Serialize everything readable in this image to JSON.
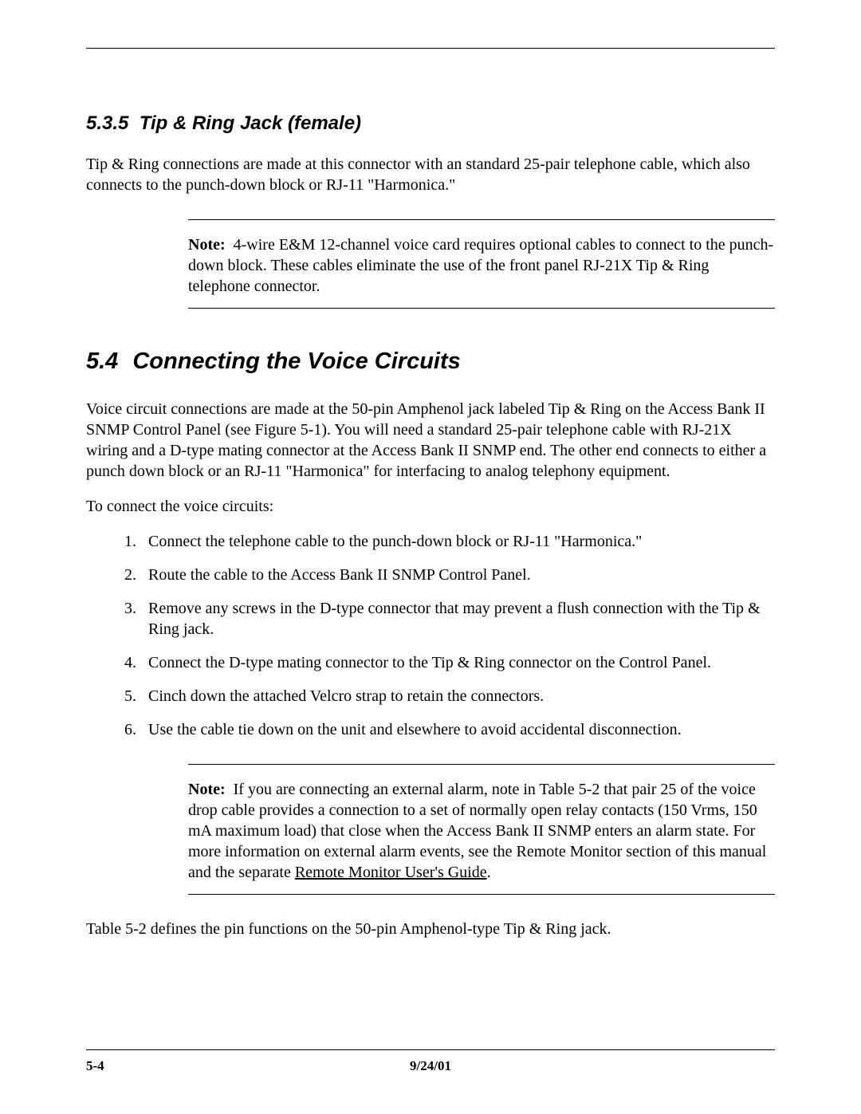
{
  "subsection": {
    "number": "5.3.5",
    "title": "Tip & Ring Jack (female)"
  },
  "para1": "Tip & Ring connections are made at this connector with an standard 25-pair telephone cable, which also connects to the punch-down block or RJ-11 \"Harmonica.\"",
  "note1": {
    "label": "Note:",
    "text": "4-wire E&M  12-channel voice card requires optional cables to connect to the punch-down block. These cables eliminate the use of the front panel RJ-21X Tip & Ring telephone connector."
  },
  "section": {
    "number": "5.4",
    "title": "Connecting the Voice Circuits"
  },
  "para2": "Voice circuit connections are made at the 50-pin Amphenol  jack labeled Tip & Ring on the Access Bank II SNMP Control Panel (see Figure 5-1). You will need a standard 25-pair telephone cable with RJ-21X wiring and a D-type mating connector at the Access Bank II SNMP end. The other end connects to either a punch down block or an RJ-11 \"Harmonica\" for interfacing to analog telephony equipment.",
  "para3": "To connect the voice circuits:",
  "steps": [
    "Connect the telephone cable to the punch-down block or RJ-11 \"Harmonica.\"",
    "Route the cable to the Access Bank II SNMP Control Panel.",
    "Remove any screws in the D-type connector that may prevent a flush connection with the Tip & Ring jack.",
    "Connect the D-type mating connector to the Tip & Ring connector on the Control Panel.",
    "Cinch down the attached Velcro strap to retain the connectors.",
    "Use the cable tie down on the unit and elsewhere to avoid accidental disconnection."
  ],
  "note2": {
    "label": "Note:",
    "text_before": "If you are connecting an external alarm, note in Table 5-2 that pair 25 of the voice drop cable provides a connection to a set of normally open relay contacts (150 Vrms, 150 mA maximum load) that close when the Access Bank II SNMP enters an alarm state. For more information on external alarm events, see the Remote Monitor section of this manual and the separate ",
    "link_text": "Remote Monitor User's Guide",
    "text_after": "."
  },
  "para4": "Table 5-2 defines the pin functions on the 50-pin Amphenol-type Tip & Ring jack.",
  "footer": {
    "page": "5-4",
    "date": "9/24/01"
  }
}
